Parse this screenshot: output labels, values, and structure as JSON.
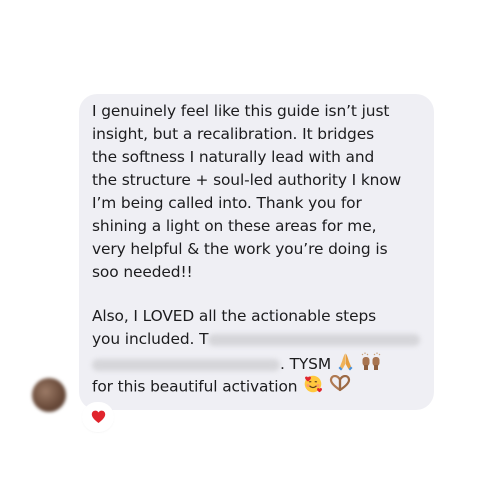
{
  "message": {
    "paragraph1": [
      "I genuinely feel like this guide isn’t just",
      "insight, but a recalibration. It bridges",
      "the softness I naturally lead with and",
      "the structure + soul-led authority I know",
      "I’m being called into. Thank you for",
      "shining a light on these areas for me,",
      "very helpful & the work you’re doing is",
      "soo needed!!"
    ],
    "paragraph2": {
      "line1": "Also, I LOVED all the actionable steps",
      "line2_visible": "you included. T",
      "line3_visible": ". TYSM",
      "line4": "for this beautiful activation"
    }
  },
  "icons": {
    "pray": "folded-hands-emoji",
    "raised_hands": "raising-hands-emoji",
    "smiling_hearts": "smiling-face-with-hearts-emoji",
    "heart_hands": "heart-hands-emoji",
    "reaction": "red-heart-emoji"
  },
  "colors": {
    "bubble": "#efeff4",
    "text": "#1c1c1e",
    "reaction_heart": "#e0242c"
  }
}
